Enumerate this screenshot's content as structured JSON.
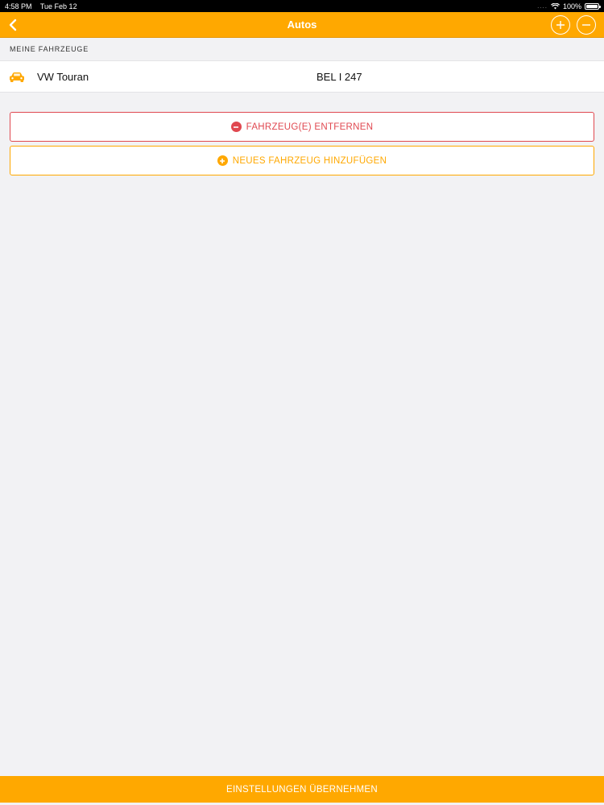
{
  "status_bar": {
    "time": "4:58 PM",
    "date": "Tue Feb 12",
    "signal": "....",
    "battery": "100%"
  },
  "navbar": {
    "title": "Autos",
    "back_icon": "chevron-left-icon",
    "add_icon": "plus-circle-icon",
    "remove_icon": "minus-circle-icon"
  },
  "section": {
    "header": "MEINE FAHRZEUGE"
  },
  "vehicles": [
    {
      "name": "VW Touran",
      "plate": "BEL I 247",
      "icon": "car-icon"
    }
  ],
  "actions": {
    "remove_label": "FAHRZEUG(E) ENTFERNEN",
    "add_label": "NEUES FAHRZEUG HINZUFÜGEN"
  },
  "footer": {
    "apply_label": "EINSTELLUNGEN ÜBERNEHMEN"
  },
  "colors": {
    "accent": "#ffa800",
    "danger": "#e04850",
    "background": "#f2f2f4"
  }
}
